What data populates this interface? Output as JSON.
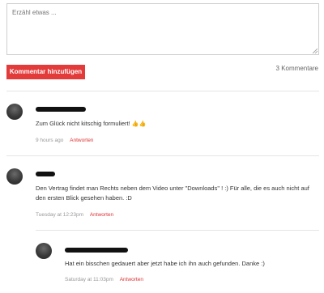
{
  "form": {
    "placeholder": "Erzähl etwas ...",
    "submit_label": "Kommentar hinzufügen",
    "count_label": "3 Kommentare"
  },
  "comments": [
    {
      "text": "Zum Glück nicht kitschig formuliert!",
      "emoji": "👍👍",
      "time": "9 hours ago",
      "reply_label": "Antworten"
    },
    {
      "text": "Den Vertrag findet man Rechts neben dem Video unter \"Downloads\" ! :) Für alle, die es auch nicht auf den ersten Blick gesehen haben. :D",
      "time": "Tuesday at 12:23pm",
      "reply_label": "Antworten"
    },
    {
      "text": "Hat ein bisschen gedauert aber jetzt habe ich ihn auch gefunden. Danke :)",
      "time": "Saturday at 11:03pm",
      "reply_label": "Antworten"
    }
  ],
  "colors": {
    "accent": "#e33a3a",
    "reply_link": "#d33333"
  }
}
